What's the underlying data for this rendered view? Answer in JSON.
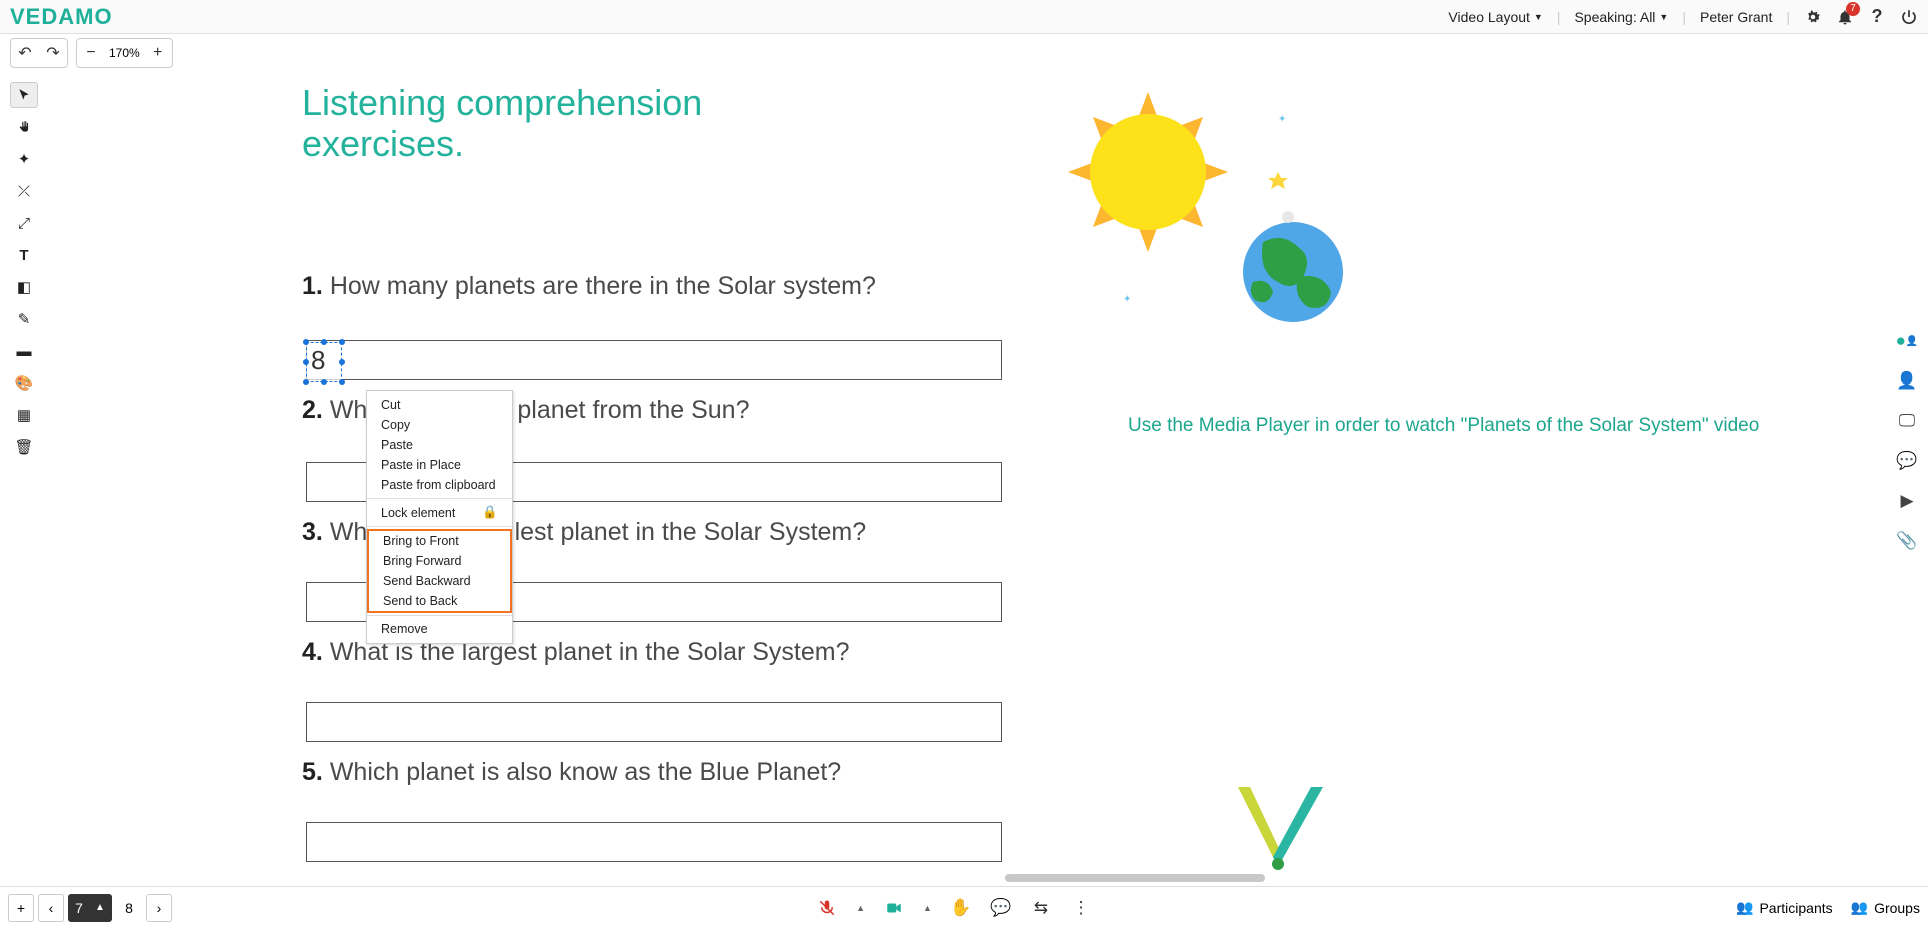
{
  "header": {
    "logo": "VEDAMO",
    "video_layout": "Video Layout",
    "speaking": "Speaking: All",
    "user": "Peter Grant",
    "notif_count": "7"
  },
  "toolbar": {
    "zoom": "170%"
  },
  "canvas": {
    "title": "Listening comprehension exercises.",
    "questions": [
      {
        "num": "1.",
        "text": "How many planets are there in the Solar system?"
      },
      {
        "num": "2.",
        "text": "What is the third planet from the Sun?"
      },
      {
        "num": "3.",
        "text": "What is the smallest planet in the Solar System?"
      },
      {
        "num": "4.",
        "text": "What is the largest planet in the Solar System?"
      },
      {
        "num": "5.",
        "text": "Which planet is also know as the Blue Planet?"
      }
    ],
    "selected_text": "8",
    "hint": "Use the Media Player in order to watch \"Planets of the Solar System\" video"
  },
  "context_menu": {
    "cut": "Cut",
    "copy": "Copy",
    "paste": "Paste",
    "paste_in_place": "Paste in Place",
    "paste_from_clipboard": "Paste from clipboard",
    "lock": "Lock element",
    "bring_front": "Bring to Front",
    "bring_forward": "Bring Forward",
    "send_backward": "Send Backward",
    "send_back": "Send to Back",
    "remove": "Remove"
  },
  "pages": {
    "current": "7",
    "next": "8"
  },
  "bottom": {
    "participants": "Participants",
    "groups": "Groups"
  }
}
